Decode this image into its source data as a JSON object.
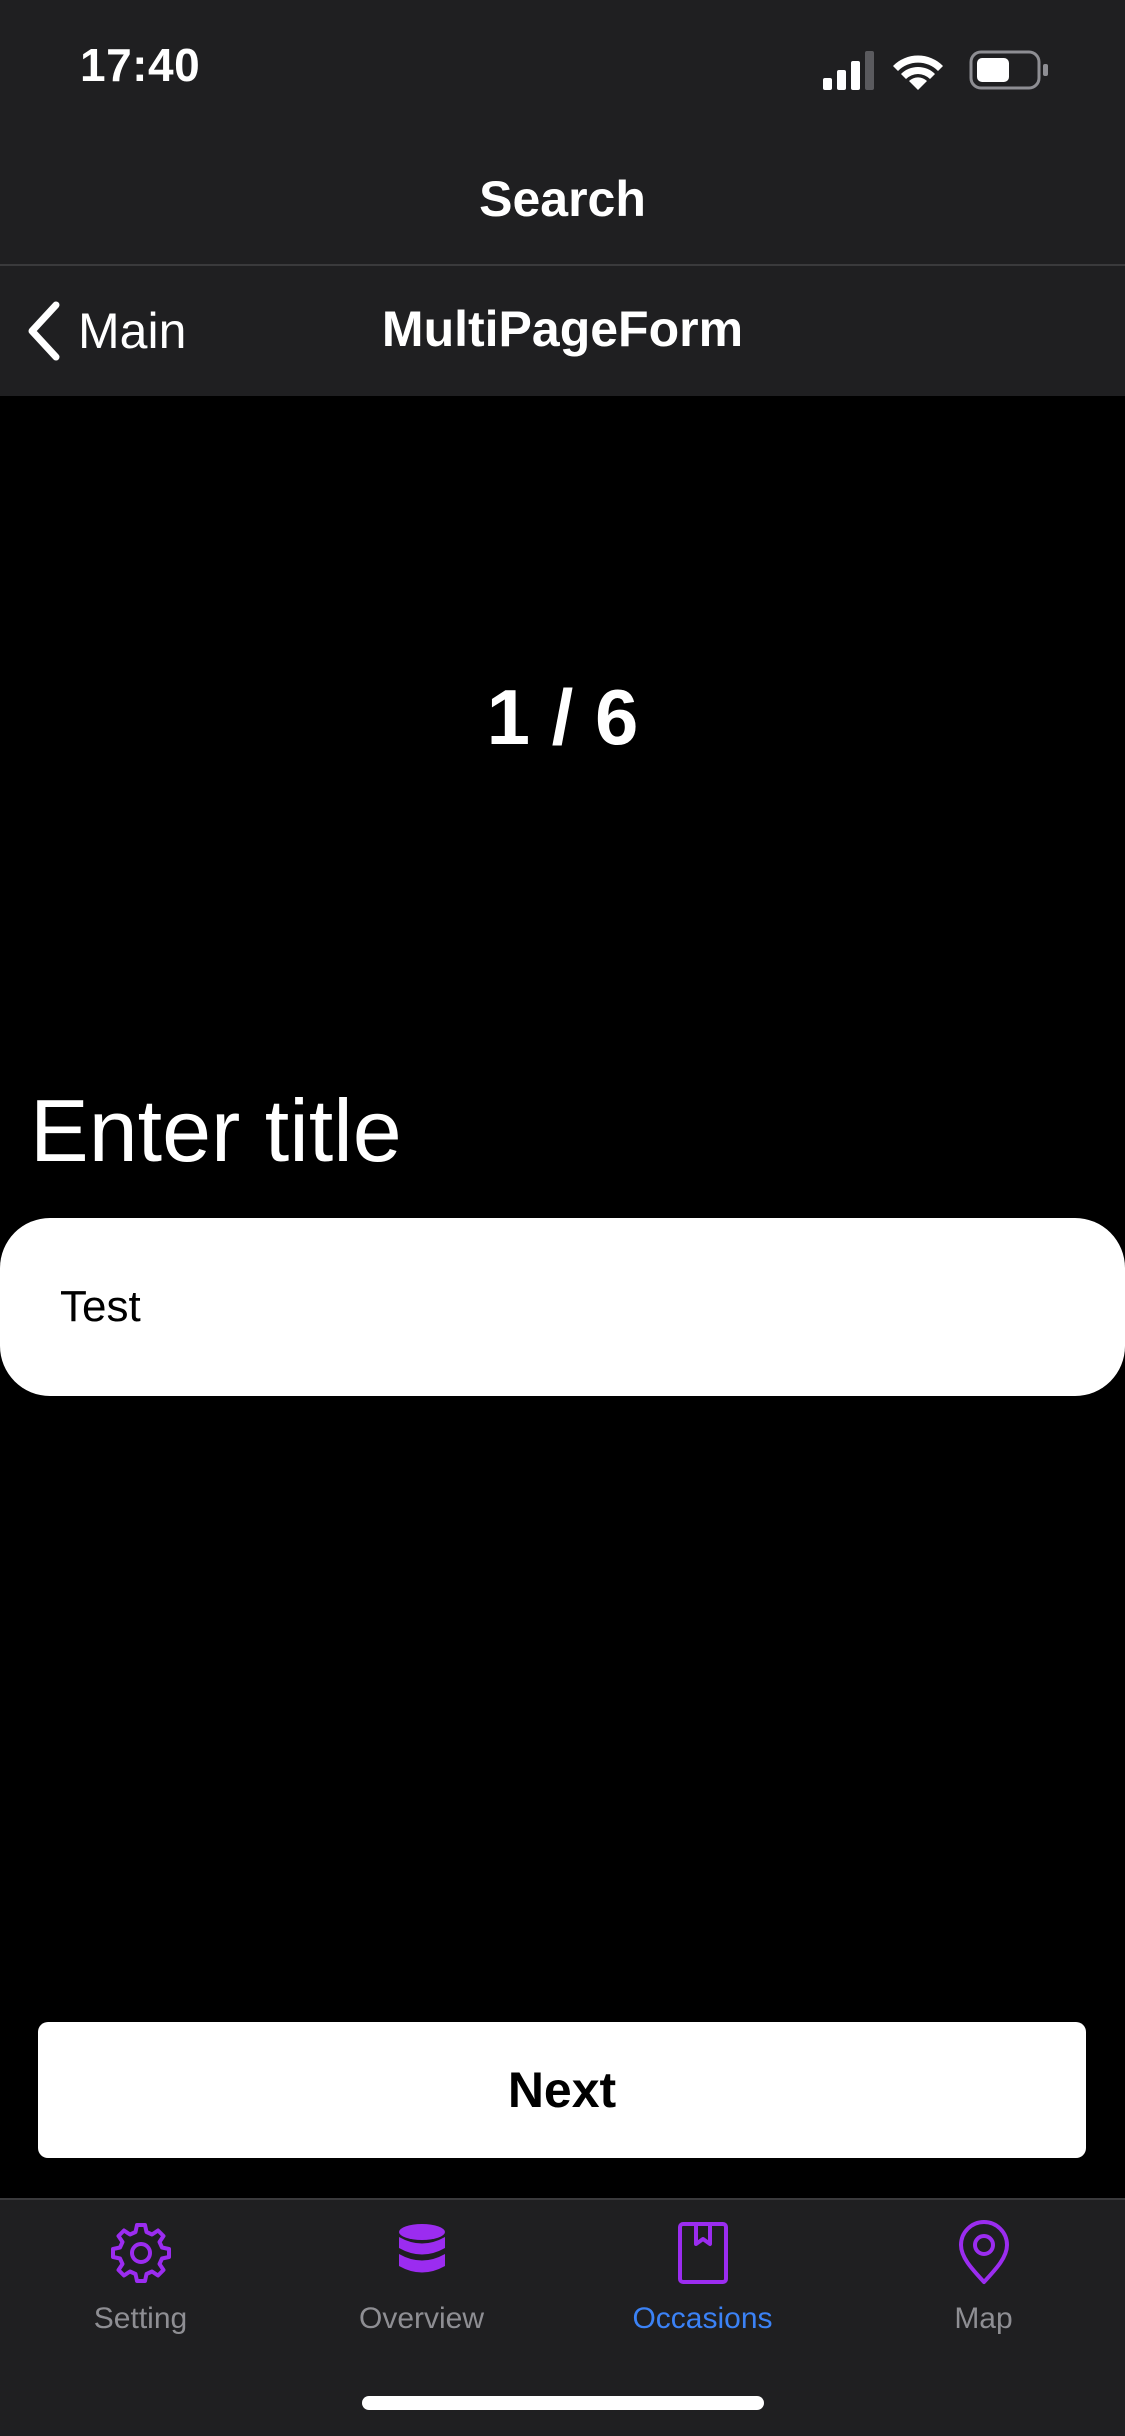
{
  "status_bar": {
    "time": "17:40"
  },
  "header": {
    "title": "Search"
  },
  "nav": {
    "back_label": "Main",
    "title": "MultiPageForm"
  },
  "form": {
    "page_counter": "1 / 6",
    "field_label": "Enter title",
    "field_value": "Test",
    "next_label": "Next"
  },
  "tab_bar": {
    "accent_color": "#9b2cf0",
    "active_label_color": "#3b82f6",
    "items": [
      {
        "label": "Setting",
        "icon": "gear-icon",
        "active": false
      },
      {
        "label": "Overview",
        "icon": "database-icon",
        "active": false
      },
      {
        "label": "Occasions",
        "icon": "bookmark-book-icon",
        "active": true
      },
      {
        "label": "Map",
        "icon": "map-pin-icon",
        "active": false
      }
    ]
  }
}
